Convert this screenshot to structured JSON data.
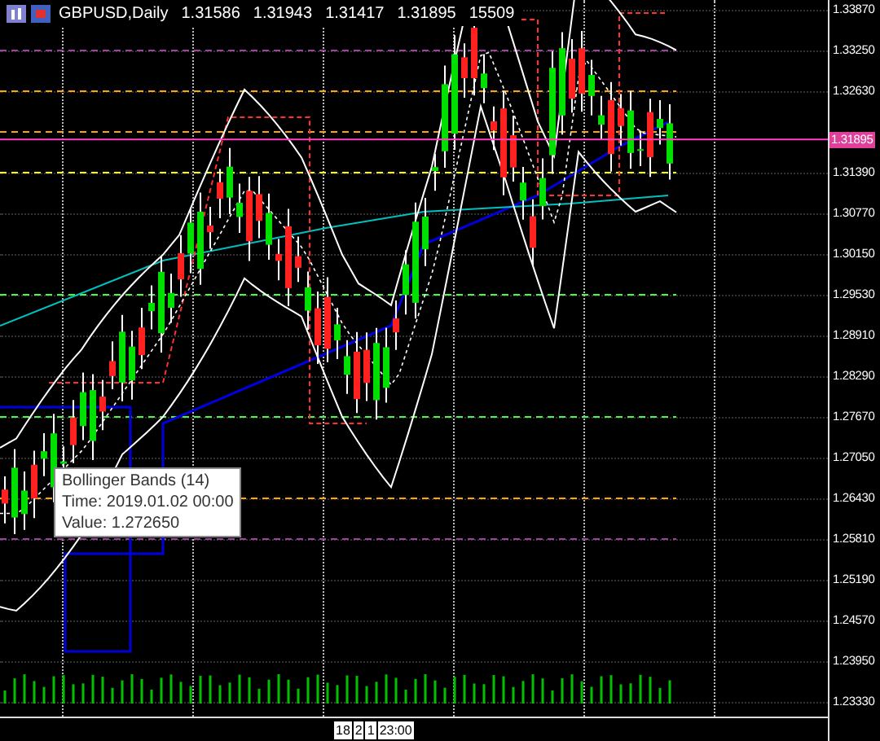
{
  "header": {
    "symbol": "GBPUSD,Daily",
    "ohlc": [
      "1.31586",
      "1.31943",
      "1.31417",
      "1.31895"
    ],
    "volume": "15509"
  },
  "price_axis": [
    "1.33870",
    "1.33250",
    "1.32630",
    "1.31390",
    "1.30770",
    "1.30150",
    "1.29530",
    "1.28910",
    "1.28290",
    "1.27670",
    "1.27050",
    "1.26430",
    "1.25810",
    "1.25190",
    "1.24570",
    "1.23950",
    "1.23330"
  ],
  "price_tag": "1.31895",
  "tooltip": {
    "title": "Bollinger Bands (14)",
    "time": "Time: 2019.01.02 00:00",
    "value": "Value: 1.272650"
  },
  "time_labels": [
    "18",
    "2",
    "1",
    "23:00"
  ]
}
